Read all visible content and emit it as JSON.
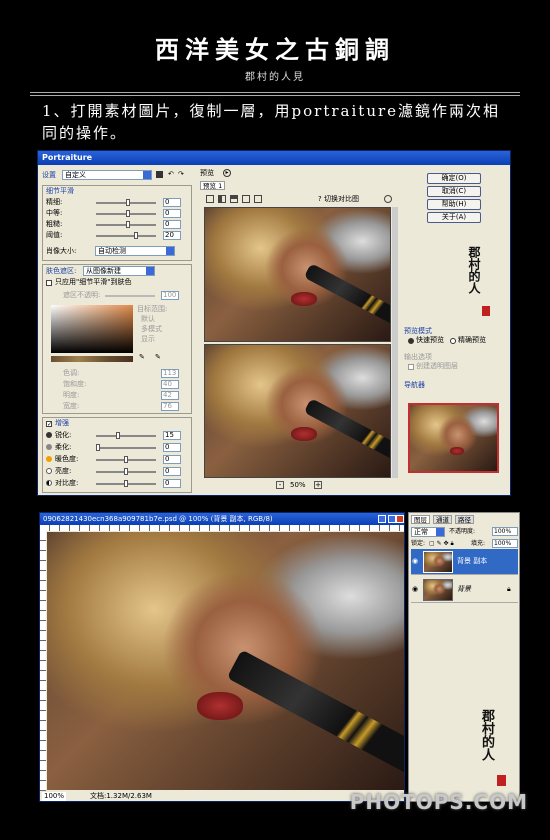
{
  "page": {
    "title": "西洋美女之古銅調",
    "subtitle": "郡村的人見",
    "step_text": "1、打開素材圖片，復制一層，用portraiture濾鏡作兩次相同的操作。",
    "watermark": "PHOTOPS.COM"
  },
  "dialog": {
    "title": "Portraiture",
    "preset_label": "设置",
    "preset_value": "自定义",
    "detail_section": "细节平滑",
    "sliders": [
      {
        "label": "精细:",
        "value": "0"
      },
      {
        "label": "中等:",
        "value": "0"
      },
      {
        "label": "粗糙:",
        "value": "0"
      },
      {
        "label": "阈值:",
        "value": "20"
      }
    ],
    "feature_size_label": "肖像大小:",
    "feature_size_value": "自动检测",
    "skin_mask_label": "肤色遮区:",
    "skin_mask_value": "从图像新建",
    "skin_checkbox": "只应用\"细节平滑\"到肤色",
    "mask_opacity_label": "遮区不透明:",
    "mask_opacity_value": "100",
    "mask_options": [
      "目标范围:",
      "默认",
      "多模式",
      "显示"
    ],
    "color_fields": [
      {
        "label": "色调:",
        "value": "113"
      },
      {
        "label": "饱和度:",
        "value": "40"
      },
      {
        "label": "明度:",
        "value": "42"
      },
      {
        "label": "宽度:",
        "value": "76"
      }
    ],
    "enhance_label": "增强",
    "enhance_rows": [
      {
        "label": "锐化:",
        "value": "15"
      },
      {
        "label": "柔化:",
        "value": "0"
      },
      {
        "label": "暖色度:",
        "value": "0"
      },
      {
        "label": "亮度:",
        "value": "0"
      },
      {
        "label": "对比度:",
        "value": "0"
      }
    ],
    "preview_header": "预览",
    "preview_tab": "预览 1",
    "preview_hint": "切换对比图",
    "zoom": "50%",
    "zoom_minus": "-",
    "zoom_plus": "+",
    "buttons": [
      "确定(O)",
      "取消(C)",
      "帮助(H)",
      "关于(A)"
    ],
    "preview_mode_label": "预览模式",
    "preview_modes": [
      "快速预览",
      "精确预览"
    ],
    "output_label": "输出选项",
    "output_checkbox": "创建透明图层",
    "navigator_label": "导航器"
  },
  "photoshop": {
    "title": "09062821430ecn368a909781b7e.psd @ 100% (背景 副本, RGB/8)",
    "status": "100%",
    "doc_info": "文档:1.32M/2.63M",
    "layers_tabs": [
      "图层",
      "通道",
      "路径"
    ],
    "blend_mode": "正常",
    "opacity_label": "不透明度:",
    "opacity_value": "100%",
    "lock_label": "锁定:",
    "fill_label": "填充:",
    "fill_value": "100%",
    "layers": [
      "背景 副本",
      "背景"
    ]
  },
  "stamp": {
    "text": "郡村的人"
  },
  "colors": {
    "accent": "#0a3fb4",
    "background": "#000000",
    "panel": "#ece9d8"
  }
}
